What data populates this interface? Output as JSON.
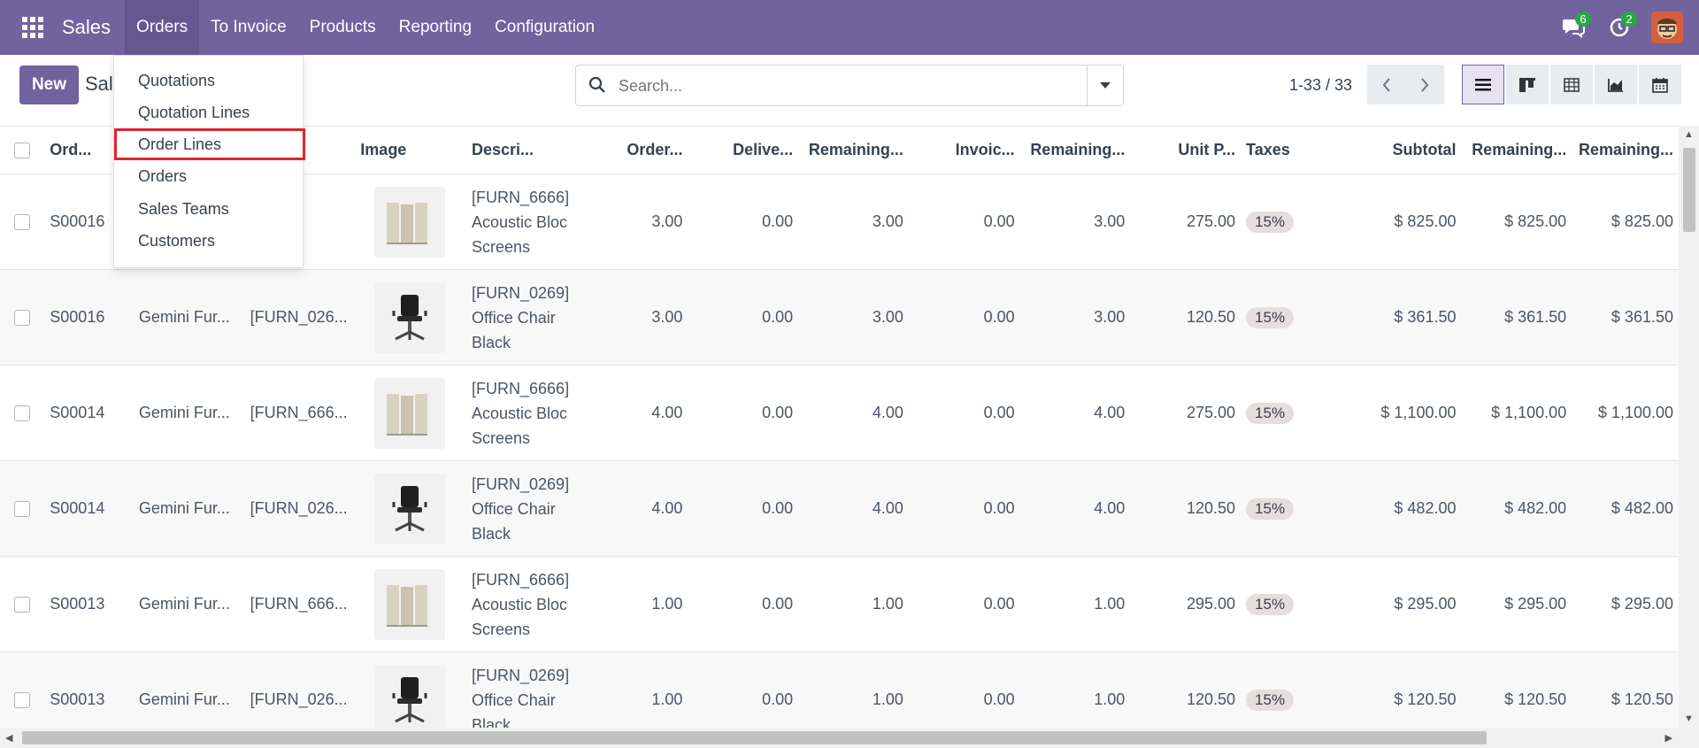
{
  "app": {
    "name": "Sales",
    "menu": [
      "Orders",
      "To Invoice",
      "Products",
      "Reporting",
      "Configuration"
    ],
    "notifications": {
      "messages_count": "6",
      "activities_count": "2"
    }
  },
  "control": {
    "new_label": "New",
    "breadcrumb": "Sale",
    "search_placeholder": "Search...",
    "pager": "1-33 / 33"
  },
  "dropdown": {
    "items": [
      "Quotations",
      "Quotation Lines",
      "Order Lines",
      "Orders",
      "Sales Teams",
      "Customers"
    ]
  },
  "table": {
    "headers": [
      "Ord...",
      "",
      "t",
      "Image",
      "Descri...",
      "Order...",
      "Delive...",
      "Remaining...",
      "Invoic...",
      "Remaining...",
      "Unit P...",
      "Taxes",
      "Subtotal",
      "Remaining...",
      "Remaining..."
    ],
    "rows": [
      {
        "order": "S00016",
        "customer": "",
        "product": "_666...",
        "desc1": "[FURN_6666]",
        "desc2": "Acoustic Bloc",
        "desc3": "Screens",
        "img": "screen",
        "ordered": "3.00",
        "delivered": "0.00",
        "rem1": "3.00",
        "invoiced": "0.00",
        "rem2": "3.00",
        "unit": "275.00",
        "tax": "15%",
        "subtotal": "$ 825.00",
        "rem3": "$ 825.00",
        "rem4": "$ 825.00"
      },
      {
        "order": "S00016",
        "customer": "Gemini Fur...",
        "product": "[FURN_026...",
        "desc1": "[FURN_0269]",
        "desc2": "Office Chair",
        "desc3": "Black",
        "img": "chair",
        "ordered": "3.00",
        "delivered": "0.00",
        "rem1": "3.00",
        "invoiced": "0.00",
        "rem2": "3.00",
        "unit": "120.50",
        "tax": "15%",
        "subtotal": "$ 361.50",
        "rem3": "$ 361.50",
        "rem4": "$ 361.50"
      },
      {
        "order": "S00014",
        "customer": "Gemini Fur...",
        "product": "[FURN_666...",
        "desc1": "[FURN_6666]",
        "desc2": "Acoustic Bloc",
        "desc3": "Screens",
        "img": "screen",
        "ordered": "4.00",
        "delivered": "0.00",
        "rem1": "4.00",
        "invoiced": "0.00",
        "rem2": "4.00",
        "unit": "275.00",
        "tax": "15%",
        "subtotal": "$ 1,100.00",
        "rem3": "$ 1,100.00",
        "rem4": "$ 1,100.00"
      },
      {
        "order": "S00014",
        "customer": "Gemini Fur...",
        "product": "[FURN_026...",
        "desc1": "[FURN_0269]",
        "desc2": "Office Chair",
        "desc3": "Black",
        "img": "chair",
        "ordered": "4.00",
        "delivered": "0.00",
        "rem1": "4.00",
        "invoiced": "0.00",
        "rem2": "4.00",
        "unit": "120.50",
        "tax": "15%",
        "subtotal": "$ 482.00",
        "rem3": "$ 482.00",
        "rem4": "$ 482.00"
      },
      {
        "order": "S00013",
        "customer": "Gemini Fur...",
        "product": "[FURN_666...",
        "desc1": "[FURN_6666]",
        "desc2": "Acoustic Bloc",
        "desc3": "Screens",
        "img": "screen",
        "ordered": "1.00",
        "delivered": "0.00",
        "rem1": "1.00",
        "invoiced": "0.00",
        "rem2": "1.00",
        "unit": "295.00",
        "tax": "15%",
        "subtotal": "$ 295.00",
        "rem3": "$ 295.00",
        "rem4": "$ 295.00"
      },
      {
        "order": "S00013",
        "customer": "Gemini Fur...",
        "product": "[FURN_026...",
        "desc1": "[FURN_0269]",
        "desc2": "Office Chair",
        "desc3": "Black",
        "img": "chair",
        "ordered": "1.00",
        "delivered": "0.00",
        "rem1": "1.00",
        "invoiced": "0.00",
        "rem2": "1.00",
        "unit": "120.50",
        "tax": "15%",
        "subtotal": "$ 120.50",
        "rem3": "$ 120.50",
        "rem4": "$ 120.50"
      }
    ]
  },
  "colors": {
    "brand": "#71639e",
    "highlight": "#e0242c",
    "badge": "#28a745"
  }
}
